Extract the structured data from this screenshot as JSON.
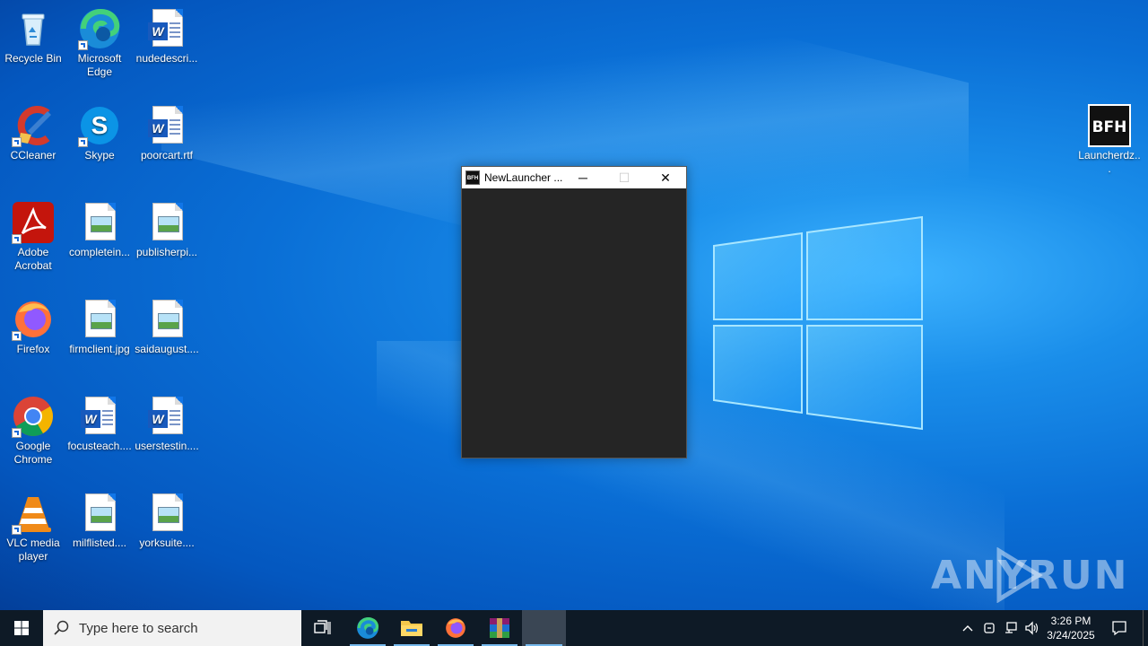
{
  "desktop": {
    "icons": [
      {
        "label": "Recycle Bin",
        "icon": "recycle-bin-icon"
      },
      {
        "label": "Microsoft Edge",
        "icon": "edge-icon"
      },
      {
        "label": "nudedescri...",
        "icon": "word-document-icon"
      },
      {
        "label": "CCleaner",
        "icon": "ccleaner-icon"
      },
      {
        "label": "Skype",
        "icon": "skype-icon"
      },
      {
        "label": "poorcart.rtf",
        "icon": "word-document-icon"
      },
      {
        "label": "Adobe Acrobat",
        "icon": "acrobat-icon"
      },
      {
        "label": "completein...",
        "icon": "image-file-icon"
      },
      {
        "label": "publisherpi...",
        "icon": "image-file-icon"
      },
      {
        "label": "Firefox",
        "icon": "firefox-icon"
      },
      {
        "label": "firmclient.jpg",
        "icon": "image-file-icon"
      },
      {
        "label": "saidaugust....",
        "icon": "image-file-icon"
      },
      {
        "label": "Google Chrome",
        "icon": "chrome-icon"
      },
      {
        "label": "focusteach....",
        "icon": "word-document-icon"
      },
      {
        "label": "userstestin....",
        "icon": "word-document-icon"
      },
      {
        "label": "VLC media player",
        "icon": "vlc-icon"
      },
      {
        "label": "milflisted....",
        "icon": "image-file-icon"
      },
      {
        "label": "yorksuite....",
        "icon": "image-file-icon"
      },
      {
        "label": "Launcherdz...",
        "icon": "bfh-launcher-icon"
      }
    ]
  },
  "window": {
    "title": "NewLauncher ...",
    "icon_text": "BFH",
    "minimize_label": "─",
    "maximize_label": "☐",
    "close_label": "✕",
    "body_color": "#252525"
  },
  "watermark": {
    "text_left": "ANY",
    "text_right": "RUN"
  },
  "taskbar": {
    "search_placeholder": "Type here to search",
    "time": "3:26 PM",
    "date": "3/24/2025",
    "items": [
      "task-view",
      "edge",
      "file-explorer",
      "firefox",
      "winrar",
      "newlauncher"
    ]
  },
  "colors": {
    "desktop_blue": "#0a6fd6",
    "taskbar": "#0e1a26",
    "accent": "#76b9ed"
  }
}
